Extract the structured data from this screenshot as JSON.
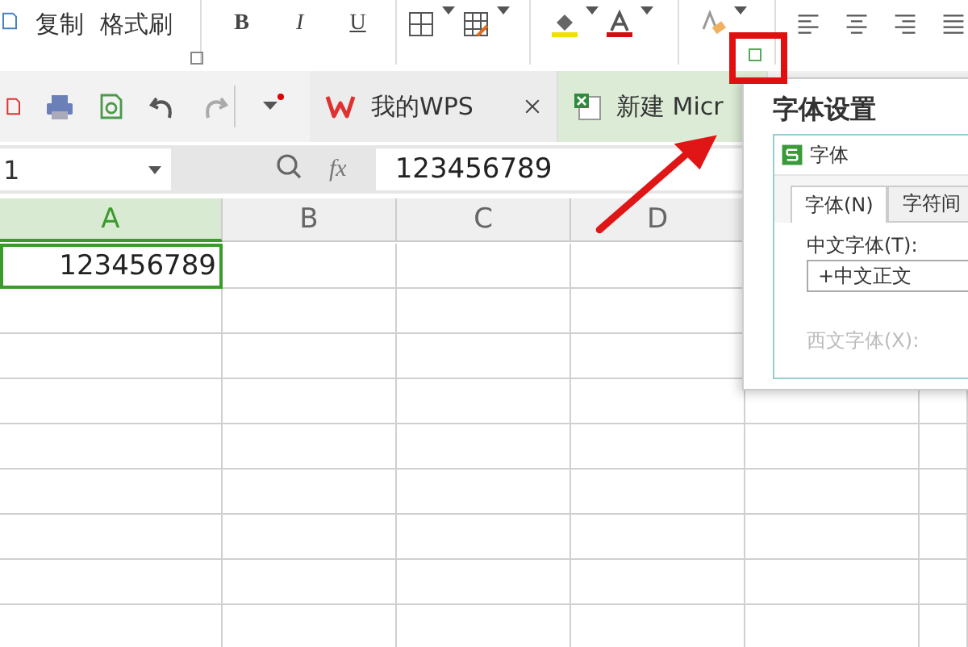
{
  "ribbon": {
    "clipboard": [
      "复制",
      "格式刷"
    ],
    "font_styles": [
      {
        "label": "B",
        "kind": "bold"
      },
      {
        "label": "I",
        "kind": "italic"
      },
      {
        "label": "U",
        "kind": "underline"
      }
    ]
  },
  "toolbar": {
    "tabs": [
      {
        "label": "我的WPS",
        "kind": "home",
        "selected": false
      },
      {
        "label": "新建 Micr",
        "kind": "sheet",
        "selected": true
      }
    ]
  },
  "formula_bar": {
    "name_box": "1",
    "fx": "fx",
    "value": "123456789"
  },
  "columns": [
    {
      "label": "A",
      "selected": true
    },
    {
      "label": "B",
      "selected": false
    },
    {
      "label": "C",
      "selected": false
    },
    {
      "label": "D",
      "selected": false
    }
  ],
  "active_cell": {
    "value": "123456789"
  },
  "dialog": {
    "title": "字体设置",
    "panel_title": "字体",
    "tabs": [
      {
        "label": "字体(N)",
        "selected": true
      },
      {
        "label": "字符间",
        "selected": false
      }
    ],
    "chinese_font": {
      "label": "中文字体(T):",
      "value": "+中文正文"
    },
    "western_font": {
      "label": "西文字体(X):"
    }
  }
}
